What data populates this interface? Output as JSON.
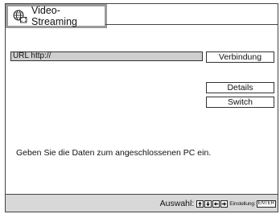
{
  "header": {
    "title": "Video-Streaming",
    "icon": "globe-film-icon"
  },
  "url_field": {
    "value": "URL  http://"
  },
  "buttons": {
    "connect": "Verbindung",
    "details": "Details",
    "switch": "Switch"
  },
  "message": "Geben Sie die Daten zum angeschlossenen PC ein.",
  "status_bar": {
    "select_label": "Auswahl:",
    "setting_label": "Einstellung:",
    "enter_key": "ENTER",
    "nav_icons": [
      "arrow-up-icon",
      "arrow-down-icon",
      "arrow-left-icon",
      "arrow-right-icon"
    ]
  },
  "colors": {
    "title_border": "#9a9a9a",
    "url_field_bg": "#cfcfcf",
    "status_bar_bg": "#d8d8d8"
  }
}
